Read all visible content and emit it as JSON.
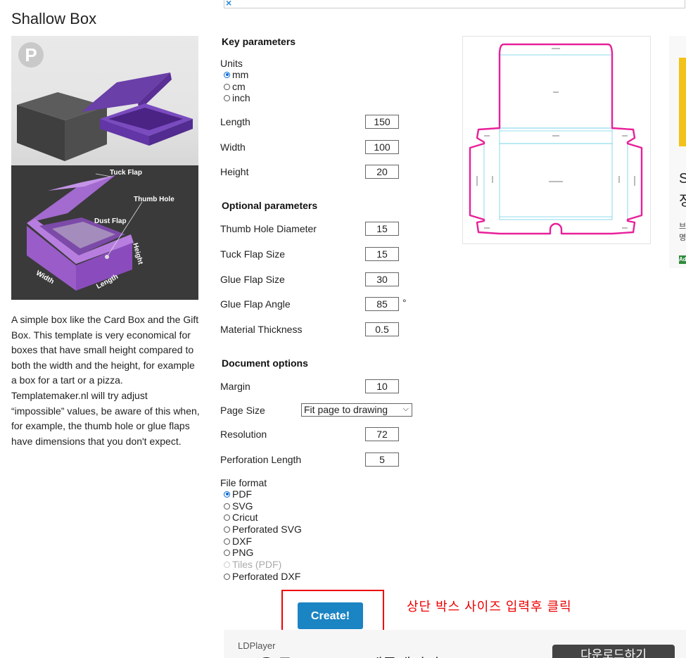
{
  "page_title": "Shallow Box",
  "pinterest_glyph": "P",
  "ad_close": "×",
  "diagram_labels": {
    "tuck_flap": "Tuck Flap",
    "thumb_hole": "Thumb Hole",
    "dust_flap": "Dust Flap",
    "height": "Height",
    "width": "Width",
    "length": "Length"
  },
  "description": "A simple box like the Card Box and the Gift Box. This template is very economical for boxes that have small height compared to both the width and the height, for example a box for a tart or a pizza. Templatemaker.nl will try adjust “impossible” values, be aware of this when, for example, the thumb hole or glue flaps have dimensions that you don't expect.",
  "key_parameters": {
    "heading": "Key parameters",
    "units_label": "Units",
    "units": [
      {
        "label": "mm",
        "selected": true
      },
      {
        "label": "cm",
        "selected": false
      },
      {
        "label": "inch",
        "selected": false
      }
    ],
    "length_label": "Length",
    "length_value": "150",
    "width_label": "Width",
    "width_value": "100",
    "height_label": "Height",
    "height_value": "20"
  },
  "optional_parameters": {
    "heading": "Optional parameters",
    "thumb_hole_label": "Thumb Hole Diameter",
    "thumb_hole_value": "15",
    "tuck_flap_label": "Tuck Flap Size",
    "tuck_flap_value": "15",
    "glue_flap_label": "Glue Flap Size",
    "glue_flap_value": "30",
    "glue_angle_label": "Glue Flap Angle",
    "glue_angle_value": "85",
    "glue_angle_unit": "°",
    "thickness_label": "Material Thickness",
    "thickness_value": "0.5"
  },
  "document_options": {
    "heading": "Document options",
    "margin_label": "Margin",
    "margin_value": "10",
    "page_size_label": "Page Size",
    "page_size_value": "Fit page to drawing",
    "resolution_label": "Resolution",
    "resolution_value": "72",
    "perforation_label": "Perforation Length",
    "perforation_value": "5",
    "file_format_label": "File format",
    "formats": [
      {
        "label": "PDF",
        "selected": true,
        "disabled": false
      },
      {
        "label": "SVG",
        "selected": false,
        "disabled": false
      },
      {
        "label": "Cricut",
        "selected": false,
        "disabled": false
      },
      {
        "label": "Perforated SVG",
        "selected": false,
        "disabled": false
      },
      {
        "label": "DXF",
        "selected": false,
        "disabled": false
      },
      {
        "label": "PNG",
        "selected": false,
        "disabled": false
      },
      {
        "label": "Tiles (PDF)",
        "selected": false,
        "disabled": true
      },
      {
        "label": "Perforated DXF",
        "selected": false,
        "disabled": false
      }
    ]
  },
  "create_button": "Create!",
  "annotation_korean": "상단 박스 사이즈 입력후 클릭",
  "ad_bottom": {
    "brand": "LDPlayer",
    "headline": "PC용 무료 Android 에뮬레이터",
    "button": "다운로드하기"
  },
  "ad_right": {
    "line1": "S",
    "line2": "정",
    "line3": "브",
    "line4": "명",
    "badge": "Ad"
  },
  "colors": {
    "accent_button": "#1b84c2",
    "annotation_red": "#e00000",
    "die_line_magenta": "#e8209a",
    "fold_line_cyan": "#6fd0e8"
  }
}
